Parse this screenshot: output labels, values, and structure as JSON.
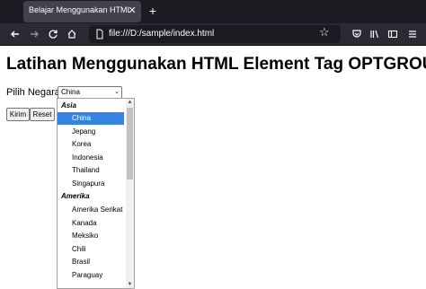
{
  "browser": {
    "tab_title": "Belajar Menggunakan HTML Element Ta",
    "tab_close": "✕",
    "new_tab": "+",
    "url": "file:///D:/sample/index.html"
  },
  "page": {
    "heading": "Latihan Menggunakan HTML Element Tag OPTGROUP",
    "label": "Pilih Negara :",
    "select_value": "China",
    "buttons": {
      "submit": "Kirim",
      "reset": "Reset"
    }
  },
  "dropdown": {
    "groups": [
      {
        "label": "Asia",
        "options": [
          "China",
          "Jepang",
          "Korea",
          "Indonesia",
          "Thailand",
          "Singapura"
        ]
      },
      {
        "label": "Amerika",
        "options": [
          "Amerika Serikat",
          "Kanada",
          "Meksiko",
          "Chili",
          "Brasil",
          "Paraguay"
        ]
      }
    ],
    "selected": "China"
  },
  "colors": {
    "highlight": "#3584e4",
    "chrome_dark": "#1c1b22",
    "toolbar": "#2b2a33"
  }
}
